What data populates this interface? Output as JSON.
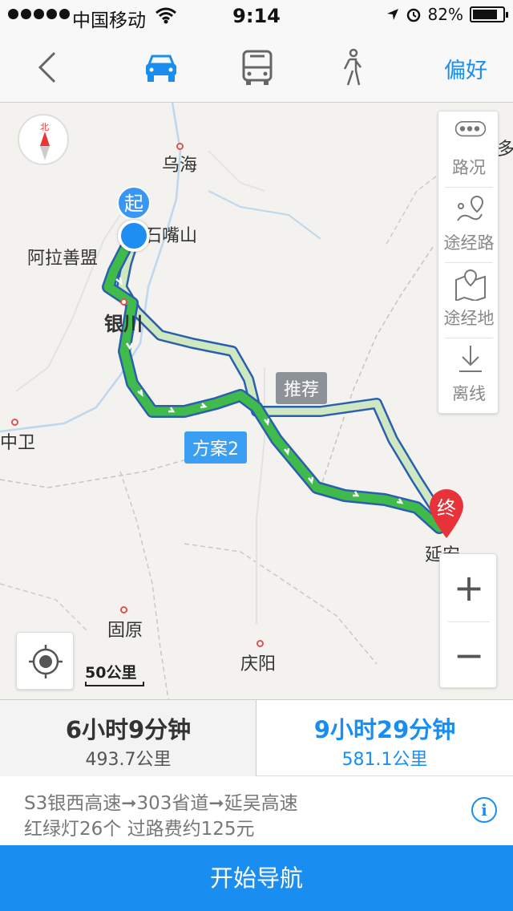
{
  "status_bar": {
    "carrier": "中国移动",
    "time": "9:14",
    "battery_text": "82%",
    "battery_level": 0.82
  },
  "nav": {
    "back_icon": "chevron-left-icon",
    "modes": [
      {
        "name": "car",
        "icon": "car-icon",
        "active": true
      },
      {
        "name": "bus",
        "icon": "bus-icon",
        "active": false
      },
      {
        "name": "walk",
        "icon": "walk-icon",
        "active": false
      }
    ],
    "preference_label": "偏好"
  },
  "map": {
    "compass_label": "北",
    "tools": [
      {
        "label": "路况",
        "icon": "traffic-icon"
      },
      {
        "label": "途经路",
        "icon": "via-road-icon"
      },
      {
        "label": "途经地",
        "icon": "via-place-icon"
      },
      {
        "label": "离线",
        "icon": "download-icon"
      }
    ],
    "cities": {
      "wuhai": "乌海",
      "shizuishan": "石嘴山",
      "alashan": "阿拉善盟",
      "yinchuan": "银川",
      "zhongwei": "中卫",
      "guyuan": "固原",
      "qingyang": "庆阳",
      "yanan": "延安",
      "edge_right": "多"
    },
    "start_label": "起",
    "end_label": "终",
    "recommend_tag": "推荐",
    "alt_tag": "方案2",
    "scale_label": "50公里",
    "zoom_in": "+",
    "zoom_out": "−"
  },
  "routes": [
    {
      "time": "6小时9分钟",
      "distance": "493.7公里",
      "selected": true
    },
    {
      "time": "9小时29分钟",
      "distance": "581.1公里",
      "selected": false
    }
  ],
  "detail": {
    "roads": "S3银西高速➞303省道➞延吴高速",
    "extra": "红绿灯26个 过路费约125元",
    "info_icon": "i"
  },
  "start_button": "开始导航",
  "colors": {
    "accent": "#1a8ef0",
    "route_main": "#39b54a",
    "route_alt": "#cfe8c2",
    "route_border": "#2a5fb0"
  }
}
